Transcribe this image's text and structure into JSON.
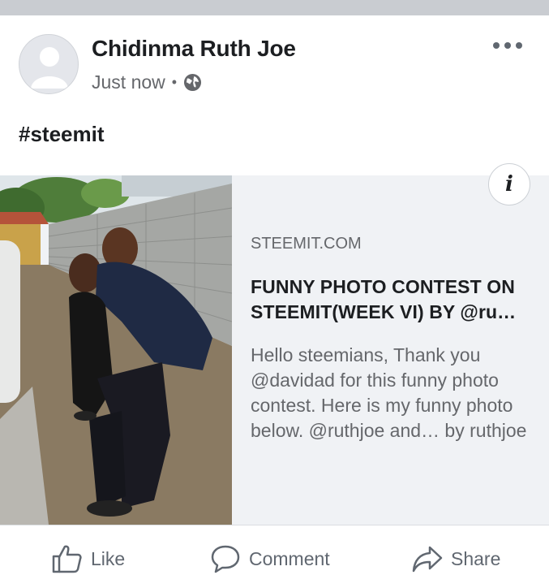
{
  "post": {
    "author": "Chidinma Ruth Joe",
    "time": "Just now",
    "separator": "•",
    "text": "#steemit"
  },
  "link": {
    "domain": "STEEMIT.COM",
    "title": "FUNNY PHOTO CONTEST ON STEEMIT(WEEK VI) BY @ru…",
    "description": "Hello steemians, Thank you @davidad for this funny photo contest. Here is my funny photo below. @ruthjoe and… by ruthjoe",
    "info_glyph": "i"
  },
  "actions": {
    "like": "Like",
    "comment": "Comment",
    "share": "Share"
  },
  "icons": [
    "avatar-placeholder-icon",
    "globe-icon",
    "more-options-icon",
    "info-icon",
    "like-icon",
    "comment-icon",
    "share-icon"
  ],
  "colors": {
    "top_bar": "#c9ccd1",
    "card_background": "#f0f2f5",
    "secondary_text": "#65676b"
  }
}
